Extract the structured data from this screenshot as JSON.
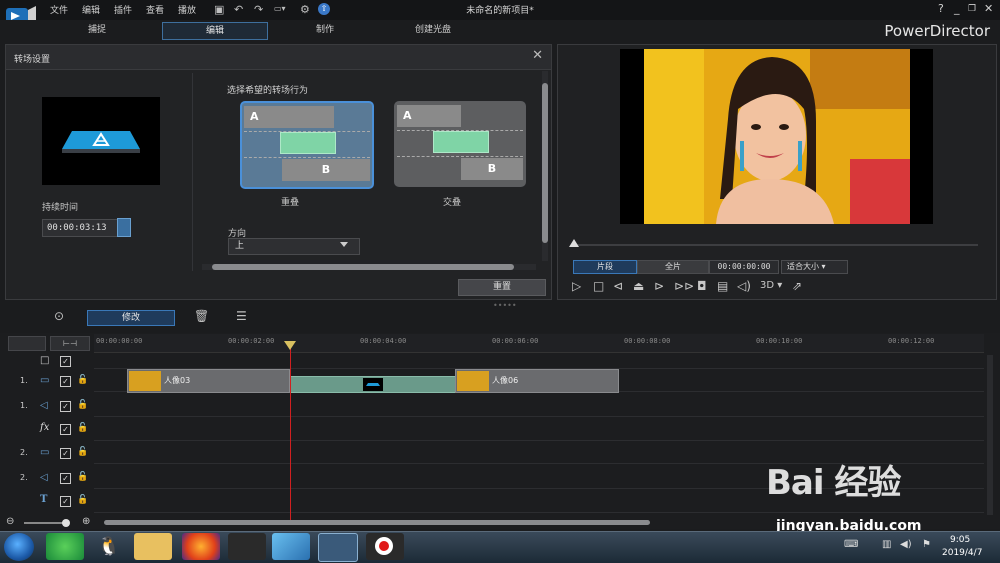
{
  "menu": [
    "文件",
    "编辑",
    "插件",
    "查看",
    "播放"
  ],
  "window_title": "未命名的新项目*",
  "mode_tabs": [
    "捕捉",
    "编辑",
    "制作",
    "创建光盘"
  ],
  "brand": "PowerDirector",
  "transition_panel": {
    "title": "转场设置",
    "duration_label": "持续时间",
    "duration_value": "00:00:03:13",
    "behavior_label": "选择希望的转场行为",
    "options": [
      {
        "label": "重叠",
        "bar_a": "A",
        "bar_b": "B",
        "selected": true
      },
      {
        "label": "交叠",
        "bar_a": "A",
        "bar_b": "B",
        "selected": false
      }
    ],
    "direction_label": "方向",
    "direction_value": "上",
    "reset_label": "重置"
  },
  "player": {
    "segment_clip": "片段",
    "segment_full": "全片",
    "timecode": "00:00:00:00",
    "fit_label": "适合大小",
    "three_d": "3D"
  },
  "toolbar": {
    "modify_label": "修改"
  },
  "timeline": {
    "ruler": [
      "00:00:00:00",
      "00:00:02:00",
      "00:00:04:00",
      "00:00:06:00",
      "00:00:08:00",
      "00:00:10:00",
      "00:00:12:00"
    ],
    "tracks": [
      {
        "num": "",
        "icon": "master"
      },
      {
        "num": "1.",
        "icon": "video"
      },
      {
        "num": "1.",
        "icon": "audio"
      },
      {
        "num": "",
        "icon": "fx"
      },
      {
        "num": "2.",
        "icon": "video"
      },
      {
        "num": "2.",
        "icon": "audio"
      },
      {
        "num": "",
        "icon": "title"
      }
    ],
    "clips": [
      {
        "name": "人像03"
      },
      {
        "name": "人像06"
      }
    ]
  },
  "taskbar": {
    "time": "9:05",
    "date": "2019/4/7"
  },
  "watermark": {
    "text": "Bai 经验",
    "url": "jingyan.baidu.com"
  },
  "colors": {
    "accent": "#3a78b8",
    "transition": "#7fd4a6",
    "playhead": "#d02020"
  }
}
